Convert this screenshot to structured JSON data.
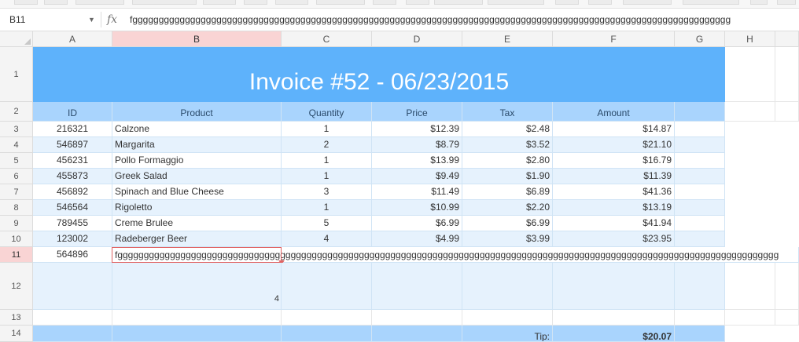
{
  "formula_bar": {
    "name_box": "B11",
    "fx_label": "fx",
    "value": "fgggggggggggggggggggggggggggggggggggggggggggggggggggggggggggggggggggggggggggggggggggggggggggggggggggggggggggggggggg"
  },
  "columns": [
    "A",
    "B",
    "C",
    "D",
    "E",
    "F",
    "G",
    "H"
  ],
  "rows": [
    "1",
    "2",
    "3",
    "4",
    "5",
    "6",
    "7",
    "8",
    "9",
    "10",
    "11",
    "12",
    "13",
    "14"
  ],
  "invoice": {
    "title": "Invoice #52 - 06/23/2015",
    "headers": [
      "ID",
      "Product",
      "Quantity",
      "Price",
      "Tax",
      "Amount"
    ],
    "items": [
      {
        "id": "216321",
        "product": "Calzone",
        "qty": "1",
        "price": "$12.39",
        "tax": "$2.48",
        "amount": "$14.87"
      },
      {
        "id": "546897",
        "product": "Margarita",
        "qty": "2",
        "price": "$8.79",
        "tax": "$3.52",
        "amount": "$21.10"
      },
      {
        "id": "456231",
        "product": "Pollo Formaggio",
        "qty": "1",
        "price": "$13.99",
        "tax": "$2.80",
        "amount": "$16.79"
      },
      {
        "id": "455873",
        "product": "Greek Salad",
        "qty": "1",
        "price": "$9.49",
        "tax": "$1.90",
        "amount": "$11.39"
      },
      {
        "id": "456892",
        "product": "Spinach and Blue Cheese",
        "qty": "3",
        "price": "$11.49",
        "tax": "$6.89",
        "amount": "$41.36"
      },
      {
        "id": "546564",
        "product": "Rigoletto",
        "qty": "1",
        "price": "$10.99",
        "tax": "$2.20",
        "amount": "$13.19"
      },
      {
        "id": "789455",
        "product": "Creme Brulee",
        "qty": "5",
        "price": "$6.99",
        "tax": "$6.99",
        "amount": "$41.94"
      },
      {
        "id": "123002",
        "product": "Radeberger Beer",
        "qty": "4",
        "price": "$4.99",
        "tax": "$3.99",
        "amount": "$23.95"
      }
    ],
    "row11": {
      "id": "564896",
      "edit_value": "fgggggggggggggggggggggggggggggggggggggggggggggggggggggggggggggggggggggggggggggggggggggggggggggggggggggggggggggggggggggggggggggg"
    },
    "row12_value": "4",
    "tip_label": "Tip:",
    "tip_value": "$20.07"
  },
  "colors": {
    "title": "#5eb2fb",
    "header": "#a9d4fd",
    "stripe": "#e6f2fd",
    "selection": "#e06363"
  }
}
